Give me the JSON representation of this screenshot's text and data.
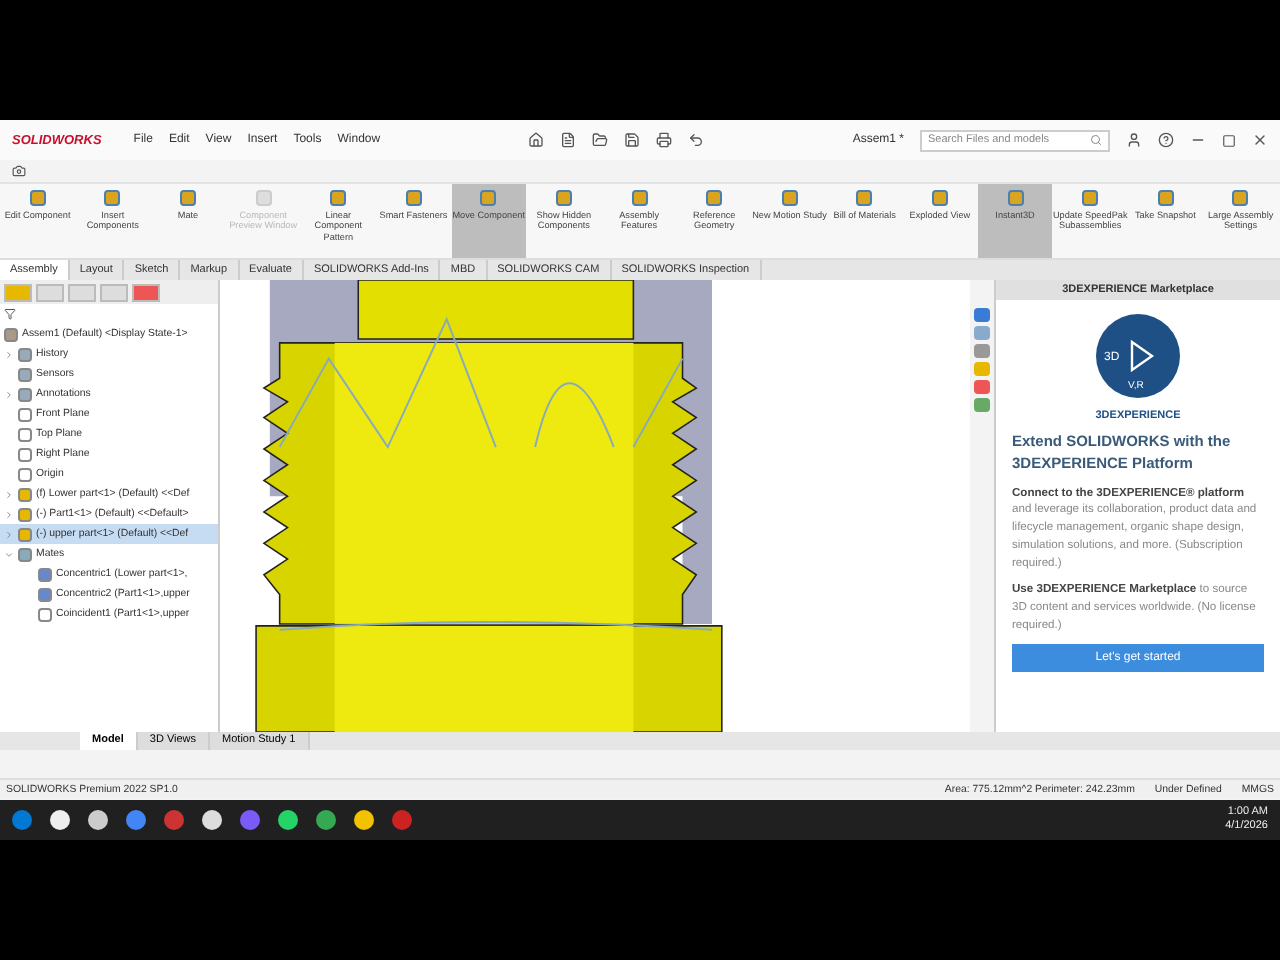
{
  "app": {
    "logo": "SOLIDWORKS",
    "menus": [
      "File",
      "Edit",
      "View",
      "Insert",
      "Tools",
      "Window"
    ],
    "document": "Assem1 *",
    "search": {
      "placeholder": "Search Files and models"
    }
  },
  "commands": [
    {
      "label": "Edit Component",
      "selected": false,
      "disabled": false
    },
    {
      "label": "Insert Components",
      "selected": false,
      "disabled": false
    },
    {
      "label": "Mate",
      "selected": false,
      "disabled": false
    },
    {
      "label": "Component Preview Window",
      "selected": false,
      "disabled": true
    },
    {
      "label": "Linear Component Pattern",
      "selected": false,
      "disabled": false
    },
    {
      "label": "Smart Fasteners",
      "selected": false,
      "disabled": false
    },
    {
      "label": "Move Component",
      "selected": true,
      "disabled": false
    },
    {
      "label": "Show Hidden Components",
      "selected": false,
      "disabled": false
    },
    {
      "label": "Assembly Features",
      "selected": false,
      "disabled": false
    },
    {
      "label": "Reference Geometry",
      "selected": false,
      "disabled": false
    },
    {
      "label": "New Motion Study",
      "selected": false,
      "disabled": false
    },
    {
      "label": "Bill of Materials",
      "selected": false,
      "disabled": false
    },
    {
      "label": "Exploded View",
      "selected": false,
      "disabled": false
    },
    {
      "label": "Instant3D",
      "selected": true,
      "disabled": false
    },
    {
      "label": "Update SpeedPak Subassemblies",
      "selected": false,
      "disabled": false
    },
    {
      "label": "Take Snapshot",
      "selected": false,
      "disabled": false
    },
    {
      "label": "Large Assembly Settings",
      "selected": false,
      "disabled": false
    }
  ],
  "tabs": [
    {
      "label": "Assembly",
      "selected": true
    },
    {
      "label": "Layout",
      "selected": false
    },
    {
      "label": "Sketch",
      "selected": false
    },
    {
      "label": "Markup",
      "selected": false
    },
    {
      "label": "Evaluate",
      "selected": false
    },
    {
      "label": "SOLIDWORKS Add-Ins",
      "selected": false
    },
    {
      "label": "MBD",
      "selected": false
    },
    {
      "label": "SOLIDWORKS CAM",
      "selected": false
    },
    {
      "label": "SOLIDWORKS Inspection",
      "selected": false
    }
  ],
  "tree": {
    "root": "Assem1 (Default) <Display State-1>",
    "items": [
      {
        "label": "History",
        "kind": "folder",
        "expanded": false,
        "selected": false
      },
      {
        "label": "Sensors",
        "kind": "folder",
        "selected": false
      },
      {
        "label": "Annotations",
        "kind": "folder",
        "expanded": false,
        "selected": false
      },
      {
        "label": "Front Plane",
        "kind": "plane",
        "selected": false
      },
      {
        "label": "Top Plane",
        "kind": "plane",
        "selected": false
      },
      {
        "label": "Right Plane",
        "kind": "plane",
        "selected": false
      },
      {
        "label": "Origin",
        "kind": "origin",
        "selected": false
      },
      {
        "label": "(f) Lower part<1> (Default) <<Def",
        "kind": "part",
        "expanded": false,
        "selected": false
      },
      {
        "label": "(-) Part1<1> (Default) <<Default>",
        "kind": "part",
        "expanded": false,
        "selected": false
      },
      {
        "label": "(-) upper part<1> (Default) <<Def",
        "kind": "part",
        "expanded": false,
        "selected": true
      },
      {
        "label": "Mates",
        "kind": "mates",
        "expanded": true,
        "selected": false,
        "children": [
          {
            "label": "Concentric1 (Lower part<1>,",
            "kind": "concentric",
            "selected": false
          },
          {
            "label": "Concentric2 (Part1<1>,upper",
            "kind": "concentric",
            "selected": false
          },
          {
            "label": "Coincident1 (Part1<1>,upper",
            "kind": "coincident",
            "selected": false
          }
        ]
      }
    ]
  },
  "task_pane": {
    "title": "3DEXPERIENCE Marketplace",
    "logo": {
      "left": "3D",
      "bottom": "V,R",
      "caption": "3DEXPERIENCE"
    },
    "heading": "Extend SOLIDWORKS with the 3DEXPERIENCE Platform",
    "paragraphs": [
      "**Connect to the 3DEXPERIENCE® platform** and leverage its collaboration, product data and lifecycle management, organic shape design, simulation solutions, and more. (Subscription required.)",
      "**Use 3DEXPERIENCE Marketplace** to source 3D content and services worldwide. (No license required.)"
    ],
    "button": "Let's get started"
  },
  "bottom_tabs": [
    {
      "label": "Model",
      "selected": true
    },
    {
      "label": "3D Views",
      "selected": false
    },
    {
      "label": "Motion Study 1",
      "selected": false
    }
  ],
  "status_bar": {
    "product": "SOLIDWORKS Premium 2022 SP1.0",
    "measure": "Area: 775.12mm^2  Perimeter: 242.23mm",
    "state": "Under Defined",
    "units": "MMGS"
  },
  "taskbar": {
    "time": "1:00 AM",
    "date": "4/1/2026"
  }
}
